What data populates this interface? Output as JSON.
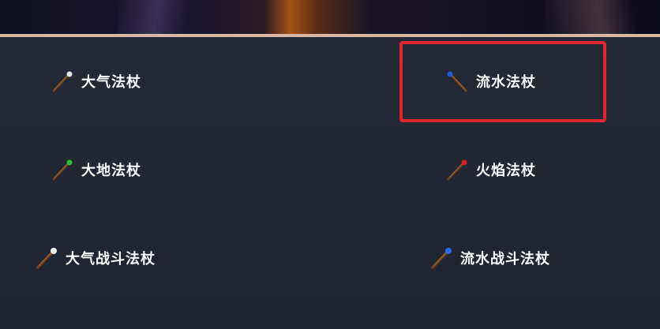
{
  "staves": [
    {
      "label": "大气法杖",
      "tip_color": "#e8e8e8"
    },
    {
      "label": "流水法杖",
      "tip_color": "#1f5bd8"
    },
    {
      "label": "大地法杖",
      "tip_color": "#21c131"
    },
    {
      "label": "火焰法杖",
      "tip_color": "#d21f1f"
    },
    {
      "label": "大气战斗法杖",
      "tip_color": "#f0f0f0"
    },
    {
      "label": "流水战斗法杖",
      "tip_color": "#2a6be8"
    }
  ],
  "highlight_color": "#e0262f"
}
